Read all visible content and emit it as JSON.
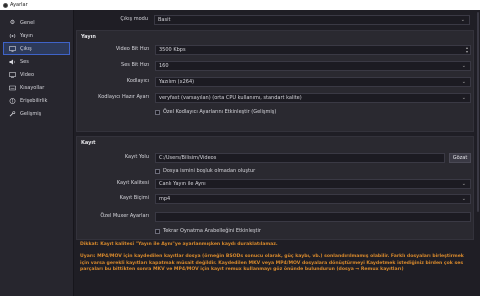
{
  "window": {
    "title": "Ayarlar"
  },
  "sidebar": {
    "items": [
      {
        "label": "Genel",
        "icon": "gear-icon"
      },
      {
        "label": "Yayın",
        "icon": "broadcast-icon"
      },
      {
        "label": "Çıkış",
        "icon": "output-icon"
      },
      {
        "label": "Ses",
        "icon": "speaker-icon"
      },
      {
        "label": "Video",
        "icon": "monitor-icon"
      },
      {
        "label": "Kısayollar",
        "icon": "keyboard-icon"
      },
      {
        "label": "Erişebilirlik",
        "icon": "accessibility-icon"
      },
      {
        "label": "Gelişmiş",
        "icon": "wrench-icon"
      }
    ],
    "active_index": 2
  },
  "output_mode": {
    "label": "Çıkış modu",
    "value": "Basit"
  },
  "stream": {
    "header": "Yayın",
    "video_bitrate": {
      "label": "Video Bit Hızı",
      "value": "3500 Kbps"
    },
    "audio_bitrate": {
      "label": "Ses Bit Hızı",
      "value": "160"
    },
    "encoder": {
      "label": "Kodlayıcı",
      "value": "Yazılım (x264)"
    },
    "encoder_preset": {
      "label": "Kodlayıcı Hazır Ayarı",
      "value": "veryfast (varsayılan) (orta CPU kullanımı, standart kalite)"
    },
    "custom_encoder": {
      "label": "Özel Kodlayıcı Ayarlarını Etkinleştir (Gelişmiş)"
    }
  },
  "recording": {
    "header": "Kayıt",
    "path": {
      "label": "Kayıt Yolu",
      "value": "C:/Users/Bilisim/Videos",
      "browse": "Gözat"
    },
    "no_space": {
      "label": "Dosya ismini boşluk olmadan oluştur"
    },
    "quality": {
      "label": "Kayıt Kalitesi",
      "value": "Canlı Yayın ile Aynı"
    },
    "format": {
      "label": "Kayıt Biçimi",
      "value": "mp4"
    },
    "muxer": {
      "label": "Özel Muxer Ayarları",
      "value": ""
    },
    "replay_buffer": {
      "label": "Tekrar Oynatma Arabelleğini Etkinleştir"
    }
  },
  "warnings": {
    "line1": "Dikkat: Kayıt kalitesi \"Yayın ile Aynı\"ye ayarlanmışken kaydı duraklatılamaz.",
    "line2": "Uyarı: MP4/MOV için kaydedilen kayıtlar dosya (örneğin BSODs sonucu olarak, güç kaybı, vb.) sonlandırılmamış olabilir. Farklı dosyaları birleştirmek için varsa gerekli kayıtları kapatmak müsait değildir. Kaydedilen MKV veya MP4/MOV dosyalara dönüştürmeyi Kaydetmek istediğiniz birden çok ses parçaları bu bittikten sonra MKV ve MP4/MOV için kayıt remux kullanmayı göz önünde bulundurun (dosya → Remux kayıtları)"
  },
  "colors": {
    "accent": "#3f63c8",
    "warning": "#d98a2c",
    "bg": "#1f1e25",
    "panel": "#2a2930"
  }
}
